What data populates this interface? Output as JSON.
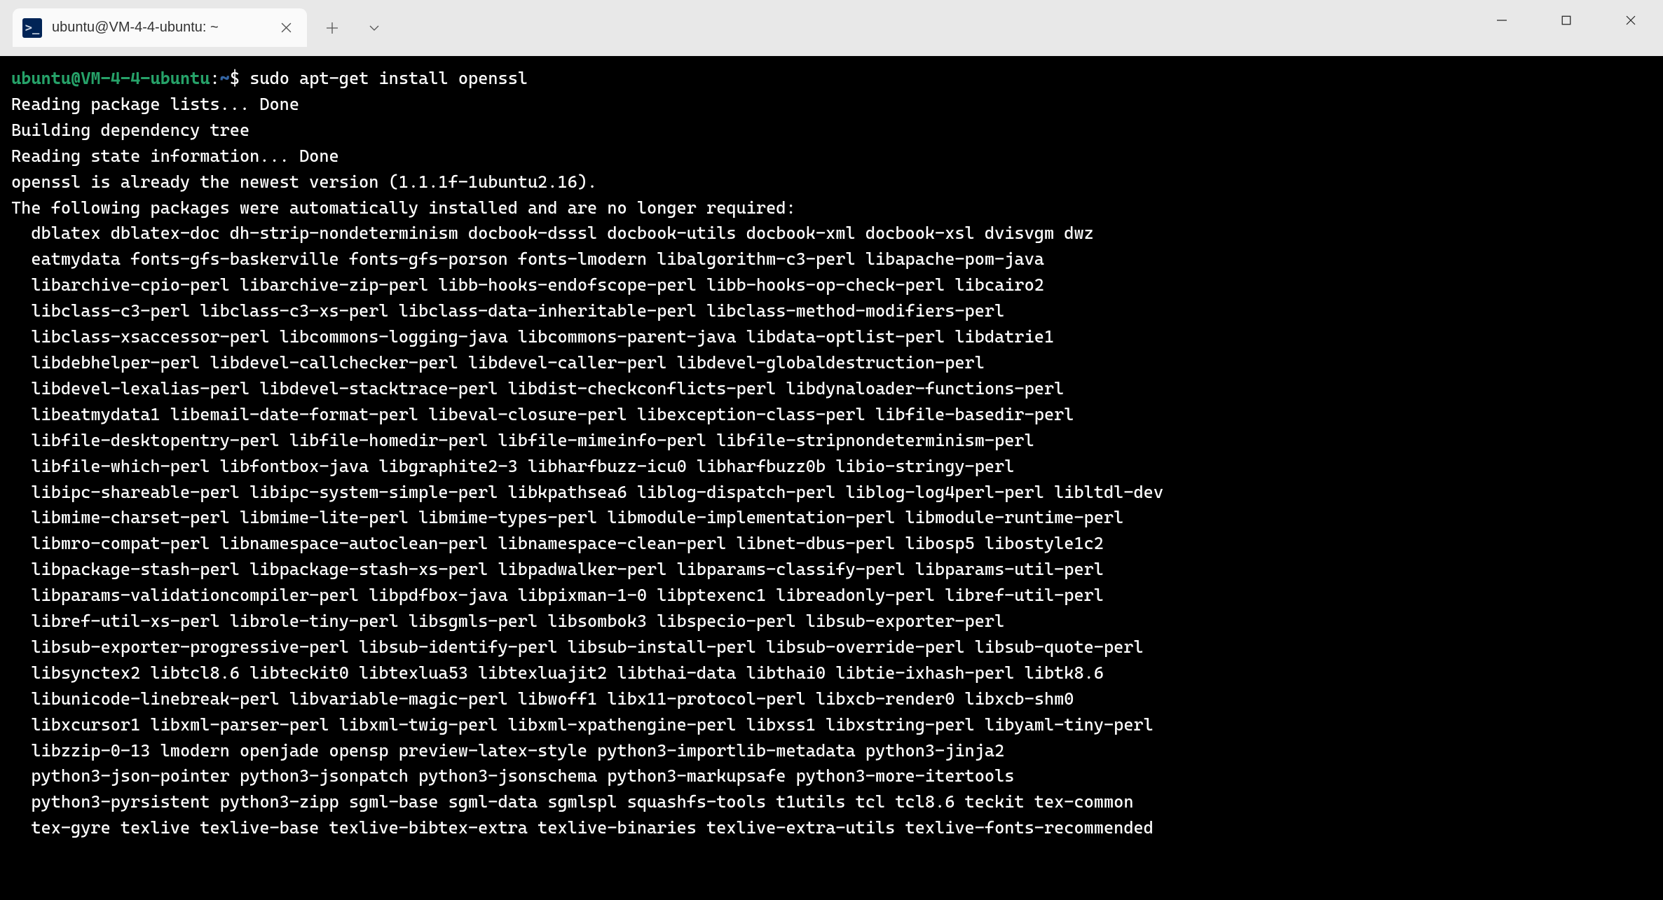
{
  "window": {
    "tab_title": "ubuntu@VM-4-4-ubuntu: ~",
    "tab_icon_glyph": ">_"
  },
  "prompt": {
    "user": "ubuntu",
    "host": "VM-4-4-ubuntu",
    "path": "~",
    "symbol": "$"
  },
  "command": "sudo apt-get install openssl",
  "output_lines": [
    "Reading package lists... Done",
    "Building dependency tree",
    "Reading state information... Done",
    "openssl is already the newest version (1.1.1f-1ubuntu2.16).",
    "The following packages were automatically installed and are no longer required:",
    "  dblatex dblatex-doc dh-strip-nondeterminism docbook-dsssl docbook-utils docbook-xml docbook-xsl dvisvgm dwz",
    "  eatmydata fonts-gfs-baskerville fonts-gfs-porson fonts-lmodern libalgorithm-c3-perl libapache-pom-java",
    "  libarchive-cpio-perl libarchive-zip-perl libb-hooks-endofscope-perl libb-hooks-op-check-perl libcairo2",
    "  libclass-c3-perl libclass-c3-xs-perl libclass-data-inheritable-perl libclass-method-modifiers-perl",
    "  libclass-xsaccessor-perl libcommons-logging-java libcommons-parent-java libdata-optlist-perl libdatrie1",
    "  libdebhelper-perl libdevel-callchecker-perl libdevel-caller-perl libdevel-globaldestruction-perl",
    "  libdevel-lexalias-perl libdevel-stacktrace-perl libdist-checkconflicts-perl libdynaloader-functions-perl",
    "  libeatmydata1 libemail-date-format-perl libeval-closure-perl libexception-class-perl libfile-basedir-perl",
    "  libfile-desktopentry-perl libfile-homedir-perl libfile-mimeinfo-perl libfile-stripnondeterminism-perl",
    "  libfile-which-perl libfontbox-java libgraphite2-3 libharfbuzz-icu0 libharfbuzz0b libio-stringy-perl",
    "  libipc-shareable-perl libipc-system-simple-perl libkpathsea6 liblog-dispatch-perl liblog-log4perl-perl libltdl-dev",
    "  libmime-charset-perl libmime-lite-perl libmime-types-perl libmodule-implementation-perl libmodule-runtime-perl",
    "  libmro-compat-perl libnamespace-autoclean-perl libnamespace-clean-perl libnet-dbus-perl libosp5 libostyle1c2",
    "  libpackage-stash-perl libpackage-stash-xs-perl libpadwalker-perl libparams-classify-perl libparams-util-perl",
    "  libparams-validationcompiler-perl libpdfbox-java libpixman-1-0 libptexenc1 libreadonly-perl libref-util-perl",
    "  libref-util-xs-perl librole-tiny-perl libsgmls-perl libsombok3 libspecio-perl libsub-exporter-perl",
    "  libsub-exporter-progressive-perl libsub-identify-perl libsub-install-perl libsub-override-perl libsub-quote-perl",
    "  libsynctex2 libtcl8.6 libteckit0 libtexlua53 libtexluajit2 libthai-data libthai0 libtie-ixhash-perl libtk8.6",
    "  libunicode-linebreak-perl libvariable-magic-perl libwoff1 libx11-protocol-perl libxcb-render0 libxcb-shm0",
    "  libxcursor1 libxml-parser-perl libxml-twig-perl libxml-xpathengine-perl libxss1 libxstring-perl libyaml-tiny-perl",
    "  libzzip-0-13 lmodern openjade opensp preview-latex-style python3-importlib-metadata python3-jinja2",
    "  python3-json-pointer python3-jsonpatch python3-jsonschema python3-markupsafe python3-more-itertools",
    "  python3-pyrsistent python3-zipp sgml-base sgml-data sgmlspl squashfs-tools t1utils tcl tcl8.6 teckit tex-common",
    "  tex-gyre texlive texlive-base texlive-bibtex-extra texlive-binaries texlive-extra-utils texlive-fonts-recommended"
  ]
}
